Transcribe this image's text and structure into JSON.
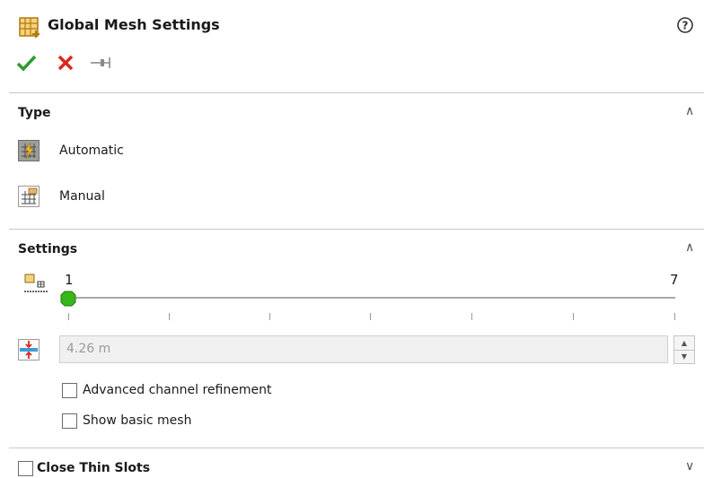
{
  "header": {
    "title": "Global Mesh Settings",
    "icons": [
      "mesh-settings-icon",
      "help-icon",
      "ok-check-icon",
      "cancel-x-icon",
      "pin-icon"
    ]
  },
  "type_section": {
    "title": "Type",
    "options": [
      {
        "label": "Automatic",
        "icon": "automatic-mesh-icon",
        "selected": true
      },
      {
        "label": "Manual",
        "icon": "manual-mesh-icon",
        "selected": false
      }
    ]
  },
  "settings_section": {
    "title": "Settings",
    "slider": {
      "min_label": "1",
      "max_label": "7",
      "value": 1,
      "icon": "level-of-initial-mesh-icon"
    },
    "min_gap": {
      "value": "4.26 m",
      "icon": "minimum-gap-size-icon",
      "enabled": false
    },
    "checkboxes": [
      {
        "label": "Advanced channel refinement",
        "checked": false
      },
      {
        "label": "Show basic mesh",
        "checked": false
      }
    ]
  },
  "close_thin_slots": {
    "label": "Close Thin Slots",
    "checked": false,
    "collapsed": true
  },
  "colors": {
    "ok": "#2e9b2e",
    "cancel": "#d9281c",
    "slider_thumb": "#39b61b",
    "selected_icon_bg": "#9e9e9e"
  }
}
